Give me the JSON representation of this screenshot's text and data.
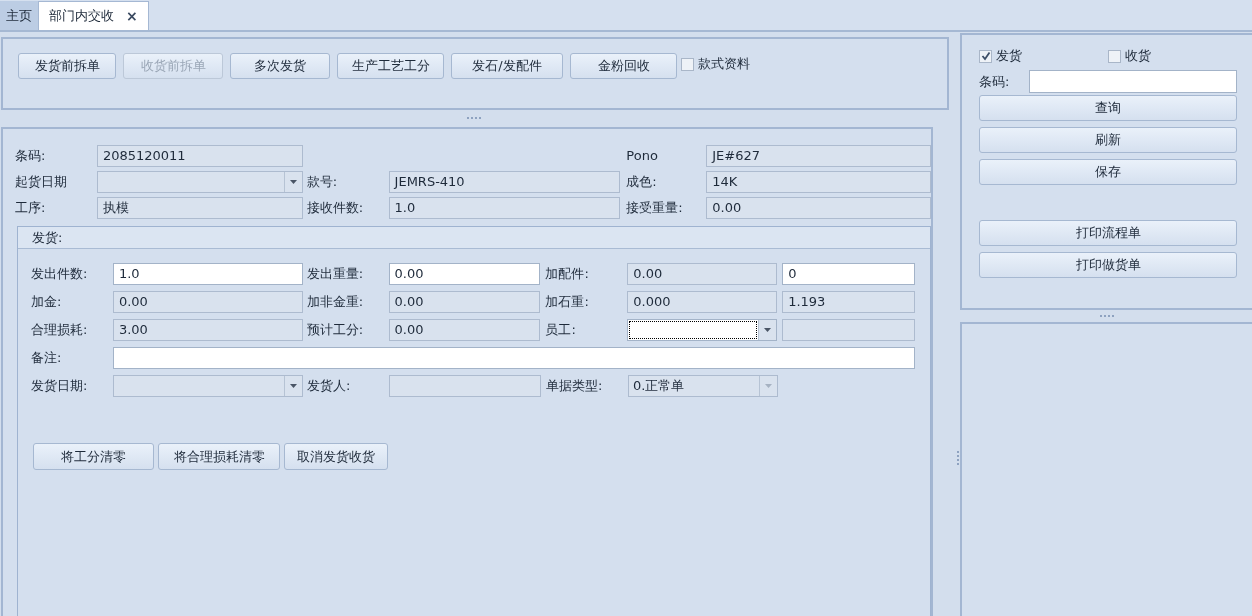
{
  "tabs": [
    {
      "label": "主页",
      "selected": false
    },
    {
      "label": "部门内交收",
      "selected": true,
      "close": "×"
    }
  ],
  "toolbar": {
    "buttons": [
      {
        "label": "发货前拆单",
        "disabled": false
      },
      {
        "label": "收货前拆单",
        "disabled": true
      },
      {
        "label": "多次发货",
        "disabled": false
      },
      {
        "label": "生产工艺工分",
        "disabled": false
      },
      {
        "label": "发石/发配件",
        "disabled": false
      },
      {
        "label": "金粉回收",
        "disabled": false
      }
    ],
    "checkbox": {
      "label": "款式资料",
      "checked": false
    }
  },
  "header_rows": [
    [
      {
        "kind": "label",
        "text": "条码:"
      },
      {
        "kind": "field",
        "value": "2085120011",
        "editable": false,
        "focused": false
      },
      {
        "kind": "empty"
      },
      {
        "kind": "empty"
      },
      {
        "kind": "label",
        "text": "Pono"
      },
      {
        "kind": "field",
        "value": "JE#627",
        "editable": false,
        "focused": false
      }
    ],
    [
      {
        "kind": "label",
        "text": "起货日期"
      },
      {
        "kind": "combo",
        "editable": false,
        "focused": false
      },
      {
        "kind": "label",
        "text": "款号:"
      },
      {
        "kind": "field",
        "value": "JEMRS-410",
        "editable": false,
        "focused": false
      },
      {
        "kind": "label",
        "text": "成色:"
      },
      {
        "kind": "field",
        "value": "14K",
        "editable": false,
        "focused": false
      }
    ],
    [
      {
        "kind": "label",
        "text": "工序:"
      },
      {
        "kind": "field",
        "value": "执模",
        "editable": false,
        "focused": false
      },
      {
        "kind": "label",
        "text": "接收件数:"
      },
      {
        "kind": "field",
        "value": "1.0",
        "editable": false,
        "focused": false
      },
      {
        "kind": "label",
        "text": "接受重量:"
      },
      {
        "kind": "field",
        "value": "0.00",
        "editable": false,
        "focused": false
      }
    ]
  ],
  "send_section": {
    "title": "发货:",
    "rows": [
      [
        {
          "kind": "label",
          "text": "发出件数:"
        },
        {
          "kind": "field",
          "value": "1.0",
          "editable": true,
          "focused": false
        },
        {
          "kind": "label",
          "text": "发出重量:"
        },
        {
          "kind": "field",
          "value": "0.00",
          "editable": true,
          "focused": false
        },
        {
          "kind": "label",
          "text": "加配件:"
        },
        {
          "kind": "field",
          "value": "0.00",
          "editable": false,
          "focused": false
        },
        {
          "kind": "field",
          "value": "0",
          "editable": true,
          "focused": false
        }
      ],
      [
        {
          "kind": "label",
          "text": "加金:"
        },
        {
          "kind": "field",
          "value": "0.00",
          "editable": false,
          "focused": false
        },
        {
          "kind": "label",
          "text": "加非金重:"
        },
        {
          "kind": "field",
          "value": "0.00",
          "editable": false,
          "focused": false
        },
        {
          "kind": "label",
          "text": "加石重:"
        },
        {
          "kind": "field",
          "value": "0.000",
          "editable": false,
          "focused": false
        },
        {
          "kind": "field",
          "value": "1.193",
          "editable": false,
          "focused": false
        }
      ],
      [
        {
          "kind": "label",
          "text": "合理损耗:"
        },
        {
          "kind": "field",
          "value": "3.00",
          "editable": false,
          "focused": false
        },
        {
          "kind": "label",
          "text": "预计工分:"
        },
        {
          "kind": "field",
          "value": "0.00",
          "editable": false,
          "focused": false
        },
        {
          "kind": "label",
          "text": "员工:"
        },
        {
          "kind": "combo",
          "editable": true,
          "focused": true
        },
        {
          "kind": "field",
          "editable": false,
          "focused": false
        }
      ],
      [
        {
          "kind": "label",
          "text": "备注:"
        },
        {
          "kind": "field",
          "editable": true,
          "focused": false
        }
      ],
      [
        {
          "kind": "label",
          "text": "发货日期:"
        },
        {
          "kind": "combo",
          "editable": false,
          "focused": false
        },
        {
          "kind": "label",
          "text": "发货人:"
        },
        {
          "kind": "field",
          "editable": false,
          "focused": false
        },
        {
          "kind": "label",
          "text": "单据类型:"
        },
        {
          "kind": "combo",
          "value": "0.正常单",
          "editable": false,
          "focused": false,
          "disabled": true
        }
      ]
    ],
    "buttons": [
      "将工分清零",
      "将合理损耗清零",
      "取消发货收货"
    ]
  },
  "side": {
    "checkboxes": [
      {
        "label": "发货",
        "checked": true
      },
      {
        "label": "收货",
        "checked": false
      }
    ],
    "barcode_label": "条码:",
    "button_groups": [
      [
        "查询",
        "刷新",
        "保存"
      ],
      [
        "打印流程单",
        "打印做货单"
      ]
    ]
  }
}
